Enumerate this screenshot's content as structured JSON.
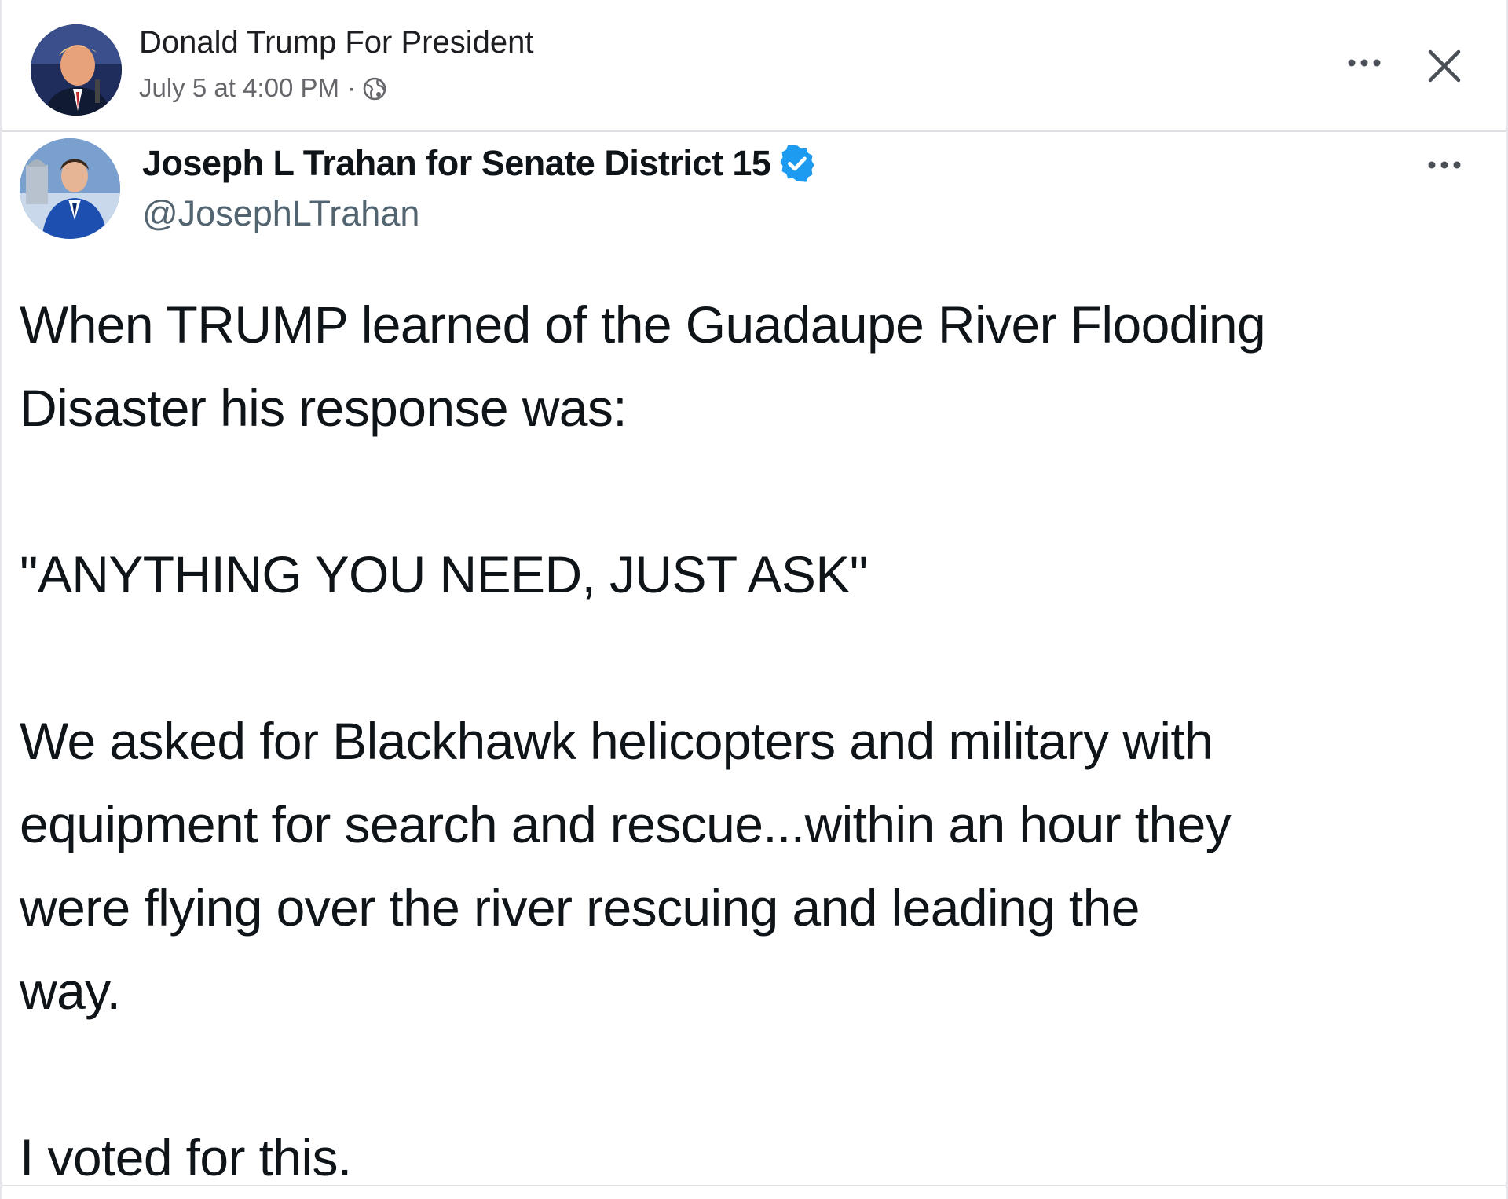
{
  "facebook_post": {
    "author": "Donald Trump For President",
    "timestamp": "July 5 at 4:00 PM",
    "separator": "·",
    "audience_icon": "globe-icon",
    "more_icon": "more-dots-icon",
    "close_icon": "close-icon"
  },
  "tweet": {
    "display_name": "Joseph L Trahan for Senate District 15",
    "handle": "@JosephLTrahan",
    "verified_icon": "verified-badge-icon",
    "more_icon": "more-dots-icon",
    "lines": {
      "p1_l1": "When TRUMP learned of the Guadaupe River Flooding",
      "p1_l2": "Disaster his response was:",
      "p2_l1": "\"ANYTHING YOU NEED, JUST ASK\"",
      "p3_l1": "We asked for Blackhawk helicopters and military with",
      "p3_l2": "equipment for search and rescue...within an hour they",
      "p3_l3": "were flying over the river rescuing and leading the",
      "p3_l4": "way.",
      "p4_l1": "I voted for this."
    }
  },
  "colors": {
    "verified_blue": "#1d9bf0",
    "meta_gray": "#65676b",
    "handle_gray": "#536471",
    "text": "#0f1419"
  }
}
